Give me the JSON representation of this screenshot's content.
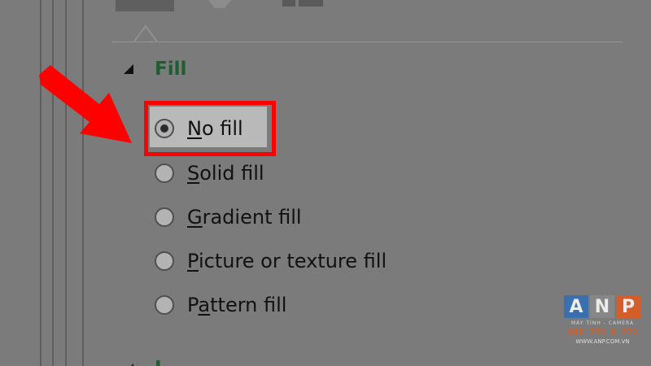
{
  "panel": {
    "section_title": "Fill",
    "next_section_title": "L"
  },
  "fill_options": [
    {
      "key": "no_fill",
      "hotkey": "N",
      "rest": "o fill",
      "selected": true
    },
    {
      "key": "solid_fill",
      "hotkey": "S",
      "rest": "olid fill",
      "selected": false
    },
    {
      "key": "gradient_fill",
      "hotkey": "G",
      "rest": "radient fill",
      "selected": false
    },
    {
      "key": "picture_or_texture_fill",
      "hotkey": "P",
      "rest": "icture or texture fill",
      "selected": false
    },
    {
      "key": "pattern_fill",
      "hotkey": "P",
      "rest": "attern fill",
      "selected": false,
      "hot_prefix": "P",
      "hot_char": "a",
      "hot_rest": "ttern fill"
    }
  ],
  "annotation": {
    "highlight_color": "#ff0000",
    "arrow_color": "#ff0000"
  },
  "watermark": {
    "letters": [
      "A",
      "N",
      "P"
    ],
    "tagline": "MÁY TÍNH - CAMERA",
    "phone": "098 772 0 772",
    "website": "WWW.ANP.COM.VN"
  },
  "icons": {
    "section_toggle": "triangle-expanded-icon",
    "annotation_arrow": "red-arrow-icon"
  }
}
